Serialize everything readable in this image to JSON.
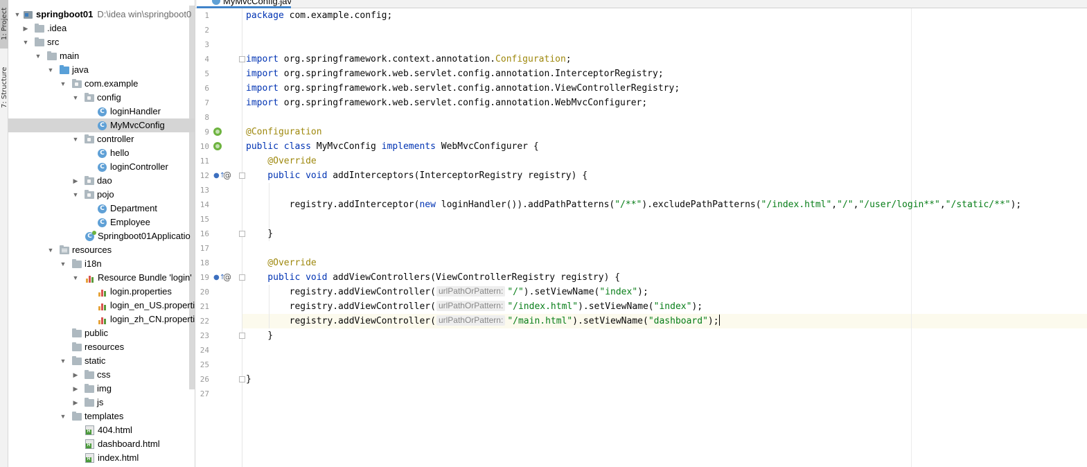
{
  "tool_strip": {
    "project_tab": "1: Project",
    "structure_tab": "7: Structure"
  },
  "project_tree": {
    "root_label": "springboot01",
    "root_path": "D:\\idea win\\springboot0",
    "items": {
      "idea": ".idea",
      "src": "src",
      "main": "main",
      "java": "java",
      "com_example": "com.example",
      "config": "config",
      "loginHandler": "loginHandler",
      "MyMvcConfig": "MyMvcConfig",
      "controller": "controller",
      "hello": "hello",
      "loginController": "loginController",
      "dao": "dao",
      "pojo": "pojo",
      "Department": "Department",
      "Employee": "Employee",
      "app": "Springboot01Applicatio",
      "resources": "resources",
      "i18n": "i18n",
      "bundle": "Resource Bundle 'login'",
      "login_props": "login.properties",
      "login_en": "login_en_US.propertie",
      "login_zh": "login_zh_CN.properti",
      "public": "public",
      "resources_sub": "resources",
      "static": "static",
      "css": "css",
      "img": "img",
      "js": "js",
      "templates": "templates",
      "html404": "404.html",
      "dashboard": "dashboard.html",
      "index": "index.html"
    },
    "class_icon_letter": "C"
  },
  "editor_tab": {
    "label": "MyMvcConfig.java",
    "close": "×"
  },
  "line_numbers": [
    "1",
    "2",
    "3",
    "4",
    "5",
    "6",
    "7",
    "8",
    "9",
    "10",
    "11",
    "12",
    "13",
    "14",
    "15",
    "16",
    "17",
    "18",
    "19",
    "20",
    "21",
    "22",
    "23",
    "24",
    "25",
    "26",
    "27"
  ],
  "code": {
    "l1_kw": "package",
    "l1_rest": " com.example.config;",
    "l4_kw": "import",
    "l4_pre": " org.springframework.context.annotation.",
    "l4_cls": "Configuration",
    "l4_end": ";",
    "l5_kw": "import",
    "l5_rest": " org.springframework.web.servlet.config.annotation.InterceptorRegistry;",
    "l6_kw": "import",
    "l6_rest": " org.springframework.web.servlet.config.annotation.ViewControllerRegistry;",
    "l7_kw": "import",
    "l7_rest": " org.springframework.web.servlet.config.annotation.WebMvcConfigurer;",
    "l9_ann": "@Configuration",
    "l10_kw1": "public class",
    "l10_name": " MyMvcConfig ",
    "l10_kw2": "implements",
    "l10_rest": " WebMvcConfigurer {",
    "l11_ann": "    @Override",
    "l12_kw": "    public void",
    "l12_rest": " addInterceptors(InterceptorRegistry registry) {",
    "l14_pre": "        registry.addInterceptor(",
    "l14_kw": "new",
    "l14_mid": " loginHandler()).addPathPatterns(",
    "l14_s1": "\"/**\"",
    "l14_mid2": ").excludePathPatterns(",
    "l14_s2": "\"/index.html\"",
    "l14_c1": ",",
    "l14_s3": "\"/\"",
    "l14_c2": ",",
    "l14_s4": "\"/user/login**\"",
    "l14_c3": ",",
    "l14_s5": "\"/static/**\"",
    "l14_end": ");",
    "l16": "    }",
    "l18_ann": "    @Override",
    "l19_kw": "    public void",
    "l19_rest": " addViewControllers(ViewControllerRegistry registry) {",
    "l20_pre": "        registry.addViewController(",
    "l20_s1": "\"/\"",
    "l20_mid": ").setViewName(",
    "l20_s2": "\"index\"",
    "l20_end": ");",
    "l21_pre": "        registry.addViewController(",
    "l21_s1": "\"/index.html\"",
    "l21_mid": ").setViewName(",
    "l21_s2": "\"index\"",
    "l21_end": ");",
    "l22_pre": "        registry.addViewController(",
    "l22_s1": "\"/main.html\"",
    "l22_mid": ").setViewName(",
    "l22_s2": "\"dashboard\"",
    "l22_end": ");",
    "l23": "    }",
    "l26": "}",
    "param_hint": "urlPathOrPattern:"
  },
  "gutter_marks": {
    "override_arrow": "●↑",
    "at_sign": "@"
  },
  "colors": {
    "keyword": "#0033b3",
    "annotation": "#9e880d",
    "string": "#067d17",
    "selection": "#d5d5d5",
    "accent": "#4083c9"
  }
}
